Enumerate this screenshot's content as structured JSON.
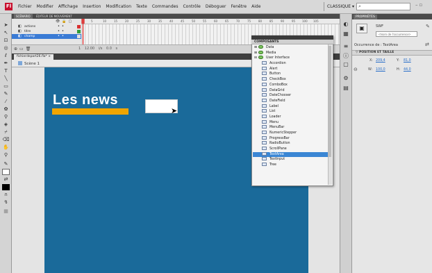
{
  "app": {
    "logo": "Fl"
  },
  "menu": [
    "Fichier",
    "Modifier",
    "Affichage",
    "Insertion",
    "Modification",
    "Texte",
    "Commandes",
    "Contrôle",
    "Déboguer",
    "Fenêtre",
    "Aide"
  ],
  "workspace": "CLASSIQUE ▾",
  "timeline": {
    "tabs": [
      "SCÉNARIO",
      "ÉDITEUR DE MOUVEMENT"
    ],
    "layers": [
      {
        "name": "actions",
        "selected": false
      },
      {
        "name": "titre",
        "selected": false
      },
      {
        "name": "champ",
        "selected": true
      }
    ],
    "frame_numbers": [
      "5",
      "10",
      "15",
      "20",
      "25",
      "30",
      "35",
      "40",
      "45",
      "50",
      "55",
      "60",
      "65",
      "70",
      "75",
      "80",
      "85",
      "90",
      "95",
      "100",
      "105"
    ],
    "footer_info": "1  12.00 i/s  0.0 s"
  },
  "document": {
    "tab": "fichierdepart26.fla* ×",
    "scene": "Scène 1"
  },
  "stage": {
    "title": "Les news",
    "background": "#1a6a9a",
    "accent": "#f0a500"
  },
  "components": {
    "title": "COMPOSANTS",
    "rows": [
      {
        "label": "Data",
        "kind": "cat",
        "expand": "⊞"
      },
      {
        "label": "Media",
        "kind": "cat",
        "expand": "⊞"
      },
      {
        "label": "User Interface",
        "kind": "cat",
        "expand": "⊟"
      },
      {
        "label": "Accordion",
        "kind": "item"
      },
      {
        "label": "Alert",
        "kind": "item"
      },
      {
        "label": "Button",
        "kind": "item"
      },
      {
        "label": "CheckBox",
        "kind": "item"
      },
      {
        "label": "ComboBox",
        "kind": "item"
      },
      {
        "label": "DataGrid",
        "kind": "item"
      },
      {
        "label": "DateChooser",
        "kind": "item"
      },
      {
        "label": "DateField",
        "kind": "item"
      },
      {
        "label": "Label",
        "kind": "item"
      },
      {
        "label": "List",
        "kind": "item"
      },
      {
        "label": "Loader",
        "kind": "item"
      },
      {
        "label": "Menu",
        "kind": "item"
      },
      {
        "label": "MenuBar",
        "kind": "item"
      },
      {
        "label": "NumericStepper",
        "kind": "item"
      },
      {
        "label": "ProgressBar",
        "kind": "item"
      },
      {
        "label": "RadioButton",
        "kind": "item"
      },
      {
        "label": "ScrollPane",
        "kind": "item"
      },
      {
        "label": "TextArea",
        "kind": "item",
        "selected": true
      },
      {
        "label": "TextInput",
        "kind": "item"
      },
      {
        "label": "Tree",
        "kind": "item"
      }
    ]
  },
  "properties": {
    "tab": "PROPRIÉTÉS",
    "symbol_type": "SWF",
    "instance_placeholder": "<Nom de l'occurrence>",
    "instance_of": "Occurrence de : TextArea",
    "section": "▽ POSITION ET TAILLE",
    "x_label": "X:",
    "x_value": "209,4",
    "y_label": "Y:",
    "y_value": "81,0",
    "w_label": "W:",
    "w_value": "100,0",
    "h_label": "H:",
    "h_value": "44,0"
  }
}
